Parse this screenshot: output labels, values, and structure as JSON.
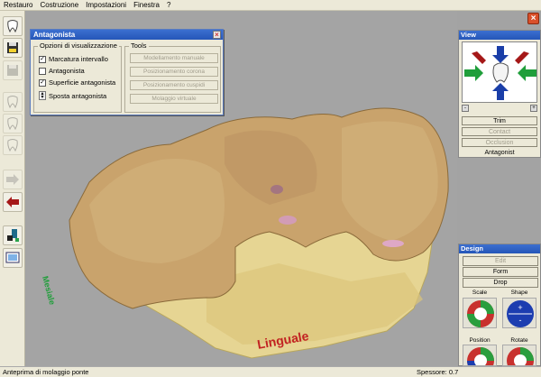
{
  "menu": [
    "Restauro",
    "Costruzione",
    "Impostazioni",
    "Finestra",
    "?"
  ],
  "dialog": {
    "title": "Antagonista",
    "close": "×",
    "group_options": "Opzioni di visualizzazione",
    "options": [
      {
        "label": "Marcatura intervallo",
        "checked": true
      },
      {
        "label": "Antagonista",
        "checked": false
      },
      {
        "label": "Superficie antagonista",
        "checked": true
      }
    ],
    "spinner_label": "Sposta antagonista",
    "group_tools": "Tools",
    "tools": [
      "Modellamento manuale",
      "Posizionamento corona",
      "Posizionamento cuspidi",
      "Molaggio virtuale"
    ]
  },
  "view_panel": {
    "title": "View",
    "buttons": [
      {
        "label": "Trim",
        "enabled": true
      },
      {
        "label": "Contact",
        "enabled": false
      },
      {
        "label": "Occlusion",
        "enabled": false
      },
      {
        "label": "Antagonist",
        "enabled": true
      }
    ]
  },
  "design_panel": {
    "title": "Design",
    "buttons": [
      {
        "label": "Edit",
        "enabled": false
      },
      {
        "label": "Form",
        "enabled": true
      },
      {
        "label": "Drop",
        "enabled": true
      }
    ],
    "controls": [
      "Scale",
      "Shape",
      "Position",
      "Rotate"
    ]
  },
  "viewport": {
    "label_bottom": "Linguale",
    "colors": {
      "tooth": "#c9a36c",
      "base": "#e8d79a",
      "marker": "#1f9e3a",
      "label": "#c22222"
    }
  },
  "status": {
    "left": "Anteprima di molaggio ponte",
    "right_label": "Spessore:",
    "right_value": "0.7"
  },
  "icons": [
    "tooth-icon",
    "save-icon",
    "save-disabled-icon",
    "tooth-outline-icon",
    "arrow-right-icon",
    "arrow-left-icon",
    "scanner-icon",
    "screen-icon"
  ]
}
